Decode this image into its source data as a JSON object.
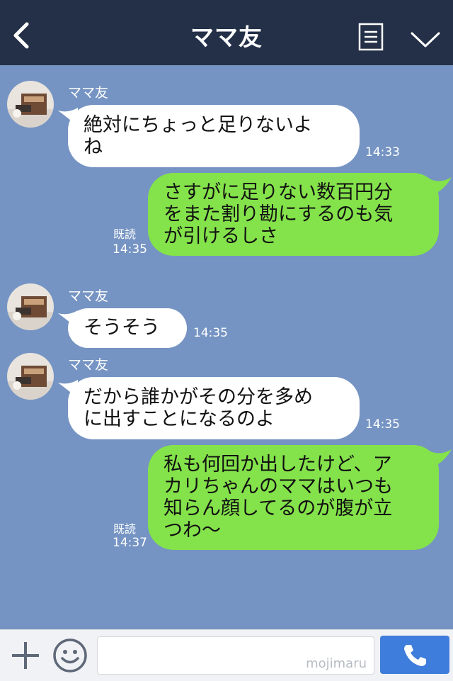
{
  "header": {
    "title": "ママ友",
    "back_icon": "chevron-left-icon",
    "menu_icon": "menu-list-icon",
    "collapse_icon": "chevron-down-icon",
    "background": "#243047"
  },
  "chat": {
    "background": "#7594c3",
    "messages": [
      {
        "sender": "ママ友",
        "text": "絶対にちょっと足りないよ\nね",
        "time": "14:33"
      },
      {
        "text": "さすがに足りない数百円分\nをまた割り勘にするのも気\nが引けるしさ",
        "read": "既読",
        "time": "14:35"
      },
      {
        "sender": "ママ友",
        "text": "そうそう",
        "time": "14:35"
      },
      {
        "sender": "ママ友",
        "text": "だから誰かがその分を多め\nに出すことになるのよ",
        "time": "14:35"
      },
      {
        "text": "私も何回か出したけど、ア\nカリちゃんのママはいつも\n知らん顔してるのが腹が立\nつわ〜",
        "read": "既読",
        "time": "14:37"
      }
    ]
  },
  "input_bar": {
    "plus_icon": "plus-icon",
    "emoji_icon": "smiley-icon",
    "watermark": "mojimaru",
    "call_icon": "phone-icon",
    "call_color": "#3f7ddc"
  },
  "colors": {
    "incoming_bubble": "#ffffff",
    "outgoing_bubble": "#84e24b"
  }
}
